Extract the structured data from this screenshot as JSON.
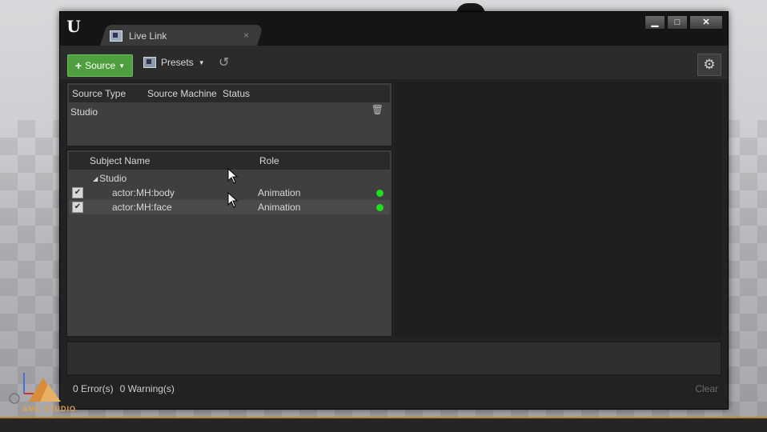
{
  "window": {
    "tab_title": "Live Link",
    "tab_close": "×",
    "controls": {
      "minimize": "▁",
      "maximize": "□",
      "close": "✕"
    }
  },
  "toolbar": {
    "source_label": "Source",
    "presets_label": "Presets"
  },
  "sources_table": {
    "columns": [
      "Source Type",
      "Source Machine",
      "Status"
    ],
    "rows": [
      {
        "type": "Studio",
        "machine": "",
        "status": ""
      }
    ]
  },
  "subjects_table": {
    "columns": [
      "Subject Name",
      "Role"
    ],
    "group": {
      "name": "Studio",
      "expanded": true
    },
    "rows": [
      {
        "name": "actor:MH:body",
        "role": "Animation",
        "checked": true,
        "status_color": "#1ee01e"
      },
      {
        "name": "actor:MH:face",
        "role": "Animation",
        "checked": true,
        "status_color": "#1ee01e"
      }
    ]
  },
  "status_bar": {
    "errors": "0 Error(s)",
    "warnings": "0 Warning(s)",
    "clear_label": "Clear"
  },
  "watermark": {
    "text": "AMC STUDIO"
  },
  "colors": {
    "accent_green": "#4f9e3f",
    "status_ok": "#1ee01e",
    "panel_bg": "#3f3f3f",
    "window_bg": "#222222"
  },
  "icons": {
    "app_logo": "unreal-logo",
    "settings": "gears-icon",
    "undo": "undo-icon",
    "remove_source": "trash-icon"
  }
}
